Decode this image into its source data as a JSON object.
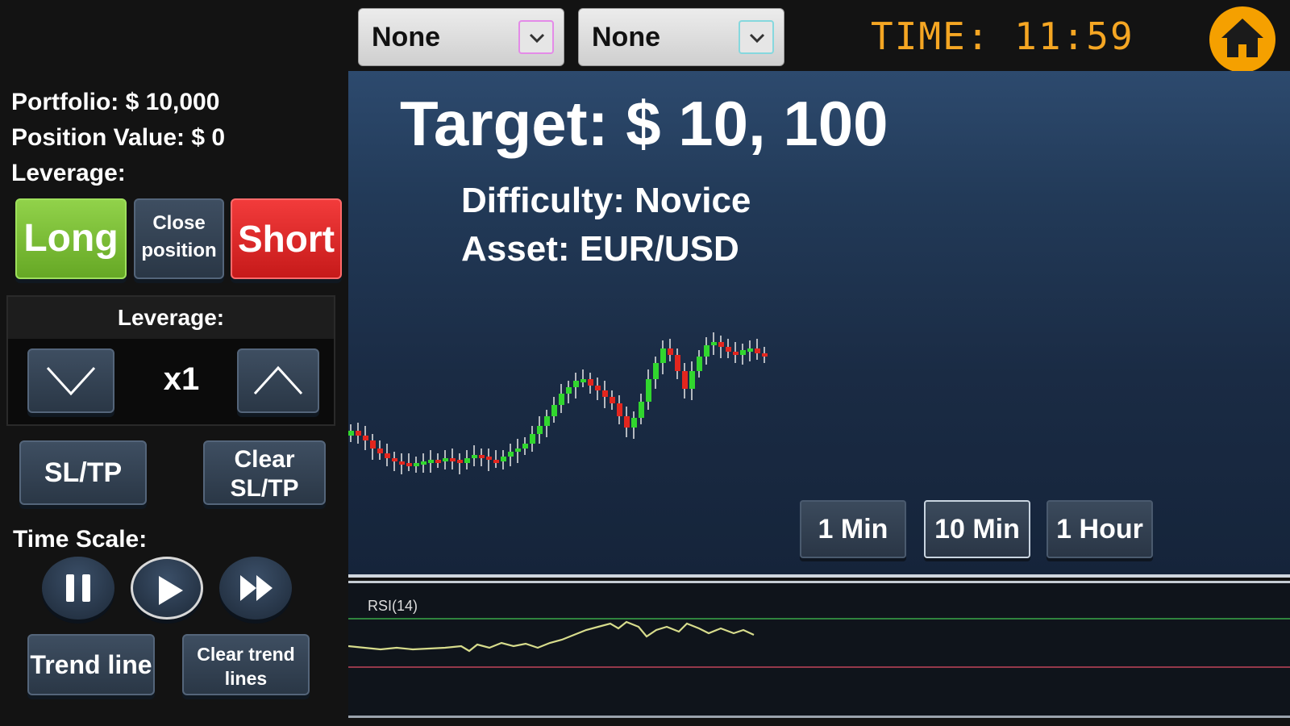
{
  "header": {
    "dropdown1": {
      "value": "None"
    },
    "dropdown2": {
      "value": "None"
    },
    "time": "TIME: 11:59"
  },
  "left": {
    "portfolio": "Portfolio:  $ 10,000",
    "position_value": "Position Value:  $ 0",
    "leverage_label": "Leverage:",
    "long_label": "Long",
    "close_label_1": "Close",
    "close_label_2": "position",
    "short_label": "Short",
    "leverage_box_title": "Leverage:",
    "leverage_value": "x1",
    "sltp_label": "SL/TP",
    "clear_sltp_1": "Clear",
    "clear_sltp_2": "SL/TP",
    "time_scale_label": "Time Scale:",
    "trend_line_label": "Trend line",
    "clear_trend_1": "Clear trend",
    "clear_trend_2": "lines"
  },
  "main": {
    "target": "Target:  $ 10, 100",
    "difficulty": "Difficulty: Novice",
    "asset": "Asset: EUR/USD",
    "timeframes": [
      "1 Min",
      "10 Min",
      "1 Hour"
    ],
    "selected_timeframe": "10 Min",
    "rsi_label": "RSI(14)"
  },
  "colors": {
    "accent_orange": "#f5a623",
    "long_green": "#7cc43a",
    "short_red": "#e52b2b",
    "candle_up": "#31d62e",
    "candle_down": "#e3261e",
    "rsi_line": "#d7dc8c"
  }
}
